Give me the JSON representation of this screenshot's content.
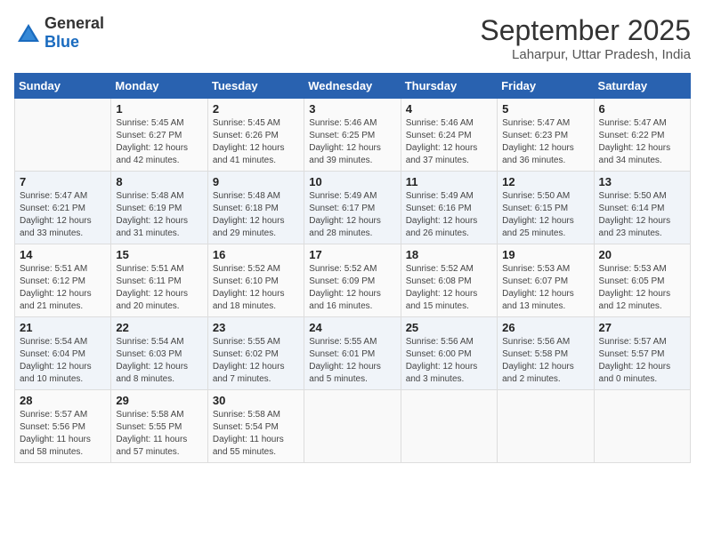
{
  "logo": {
    "text_general": "General",
    "text_blue": "Blue"
  },
  "title": "September 2025",
  "location": "Laharpur, Uttar Pradesh, India",
  "weekdays": [
    "Sunday",
    "Monday",
    "Tuesday",
    "Wednesday",
    "Thursday",
    "Friday",
    "Saturday"
  ],
  "weeks": [
    [
      {
        "day": "",
        "info": ""
      },
      {
        "day": "1",
        "info": "Sunrise: 5:45 AM\nSunset: 6:27 PM\nDaylight: 12 hours\nand 42 minutes."
      },
      {
        "day": "2",
        "info": "Sunrise: 5:45 AM\nSunset: 6:26 PM\nDaylight: 12 hours\nand 41 minutes."
      },
      {
        "day": "3",
        "info": "Sunrise: 5:46 AM\nSunset: 6:25 PM\nDaylight: 12 hours\nand 39 minutes."
      },
      {
        "day": "4",
        "info": "Sunrise: 5:46 AM\nSunset: 6:24 PM\nDaylight: 12 hours\nand 37 minutes."
      },
      {
        "day": "5",
        "info": "Sunrise: 5:47 AM\nSunset: 6:23 PM\nDaylight: 12 hours\nand 36 minutes."
      },
      {
        "day": "6",
        "info": "Sunrise: 5:47 AM\nSunset: 6:22 PM\nDaylight: 12 hours\nand 34 minutes."
      }
    ],
    [
      {
        "day": "7",
        "info": "Sunrise: 5:47 AM\nSunset: 6:21 PM\nDaylight: 12 hours\nand 33 minutes."
      },
      {
        "day": "8",
        "info": "Sunrise: 5:48 AM\nSunset: 6:19 PM\nDaylight: 12 hours\nand 31 minutes."
      },
      {
        "day": "9",
        "info": "Sunrise: 5:48 AM\nSunset: 6:18 PM\nDaylight: 12 hours\nand 29 minutes."
      },
      {
        "day": "10",
        "info": "Sunrise: 5:49 AM\nSunset: 6:17 PM\nDaylight: 12 hours\nand 28 minutes."
      },
      {
        "day": "11",
        "info": "Sunrise: 5:49 AM\nSunset: 6:16 PM\nDaylight: 12 hours\nand 26 minutes."
      },
      {
        "day": "12",
        "info": "Sunrise: 5:50 AM\nSunset: 6:15 PM\nDaylight: 12 hours\nand 25 minutes."
      },
      {
        "day": "13",
        "info": "Sunrise: 5:50 AM\nSunset: 6:14 PM\nDaylight: 12 hours\nand 23 minutes."
      }
    ],
    [
      {
        "day": "14",
        "info": "Sunrise: 5:51 AM\nSunset: 6:12 PM\nDaylight: 12 hours\nand 21 minutes."
      },
      {
        "day": "15",
        "info": "Sunrise: 5:51 AM\nSunset: 6:11 PM\nDaylight: 12 hours\nand 20 minutes."
      },
      {
        "day": "16",
        "info": "Sunrise: 5:52 AM\nSunset: 6:10 PM\nDaylight: 12 hours\nand 18 minutes."
      },
      {
        "day": "17",
        "info": "Sunrise: 5:52 AM\nSunset: 6:09 PM\nDaylight: 12 hours\nand 16 minutes."
      },
      {
        "day": "18",
        "info": "Sunrise: 5:52 AM\nSunset: 6:08 PM\nDaylight: 12 hours\nand 15 minutes."
      },
      {
        "day": "19",
        "info": "Sunrise: 5:53 AM\nSunset: 6:07 PM\nDaylight: 12 hours\nand 13 minutes."
      },
      {
        "day": "20",
        "info": "Sunrise: 5:53 AM\nSunset: 6:05 PM\nDaylight: 12 hours\nand 12 minutes."
      }
    ],
    [
      {
        "day": "21",
        "info": "Sunrise: 5:54 AM\nSunset: 6:04 PM\nDaylight: 12 hours\nand 10 minutes."
      },
      {
        "day": "22",
        "info": "Sunrise: 5:54 AM\nSunset: 6:03 PM\nDaylight: 12 hours\nand 8 minutes."
      },
      {
        "day": "23",
        "info": "Sunrise: 5:55 AM\nSunset: 6:02 PM\nDaylight: 12 hours\nand 7 minutes."
      },
      {
        "day": "24",
        "info": "Sunrise: 5:55 AM\nSunset: 6:01 PM\nDaylight: 12 hours\nand 5 minutes."
      },
      {
        "day": "25",
        "info": "Sunrise: 5:56 AM\nSunset: 6:00 PM\nDaylight: 12 hours\nand 3 minutes."
      },
      {
        "day": "26",
        "info": "Sunrise: 5:56 AM\nSunset: 5:58 PM\nDaylight: 12 hours\nand 2 minutes."
      },
      {
        "day": "27",
        "info": "Sunrise: 5:57 AM\nSunset: 5:57 PM\nDaylight: 12 hours\nand 0 minutes."
      }
    ],
    [
      {
        "day": "28",
        "info": "Sunrise: 5:57 AM\nSunset: 5:56 PM\nDaylight: 11 hours\nand 58 minutes."
      },
      {
        "day": "29",
        "info": "Sunrise: 5:58 AM\nSunset: 5:55 PM\nDaylight: 11 hours\nand 57 minutes."
      },
      {
        "day": "30",
        "info": "Sunrise: 5:58 AM\nSunset: 5:54 PM\nDaylight: 11 hours\nand 55 minutes."
      },
      {
        "day": "",
        "info": ""
      },
      {
        "day": "",
        "info": ""
      },
      {
        "day": "",
        "info": ""
      },
      {
        "day": "",
        "info": ""
      }
    ]
  ]
}
